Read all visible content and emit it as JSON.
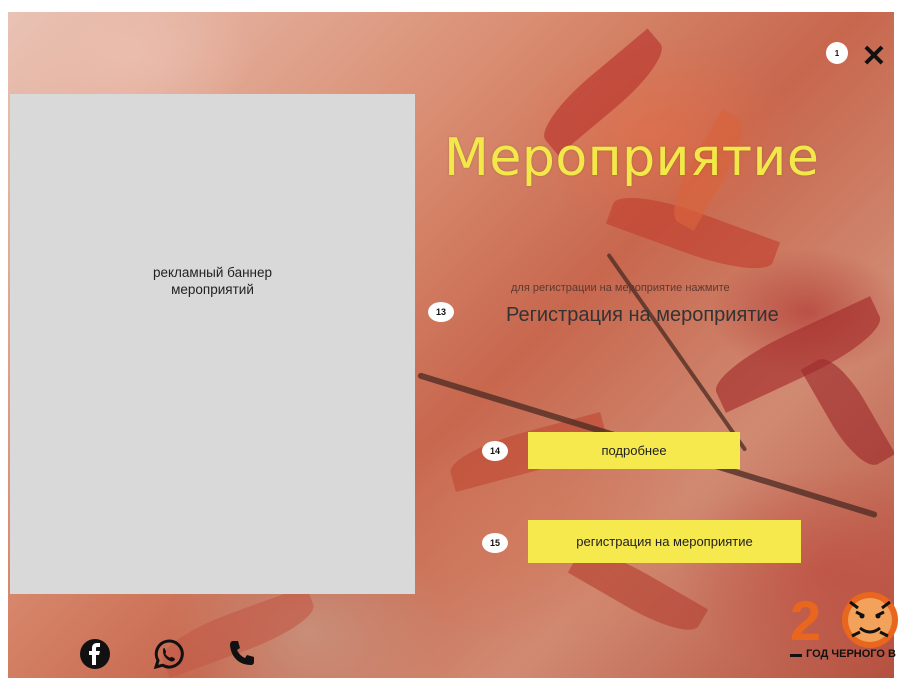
{
  "close": {
    "marker": "1",
    "label": "✕"
  },
  "banner": {
    "line1": "рекламный баннер",
    "line2": "мероприятий"
  },
  "title": "Мероприятие",
  "registration": {
    "hint": "для регистрации на мероприятие нажмите",
    "heading": "Регистрация на мероприятие",
    "marker": "13"
  },
  "buttons": {
    "details": {
      "label": "подробнее",
      "marker": "14"
    },
    "register": {
      "label": "регистрация на мероприятие",
      "marker": "15"
    }
  },
  "social": {
    "icons": [
      "facebook-icon",
      "whatsapp-icon",
      "phone-icon"
    ]
  },
  "logo": {
    "number": "20",
    "caption": "ГОД ЧЕРНОГО В"
  },
  "colors": {
    "accent": "#f5e94e",
    "title": "#f3e84a",
    "banner": "#d9d9d9"
  }
}
